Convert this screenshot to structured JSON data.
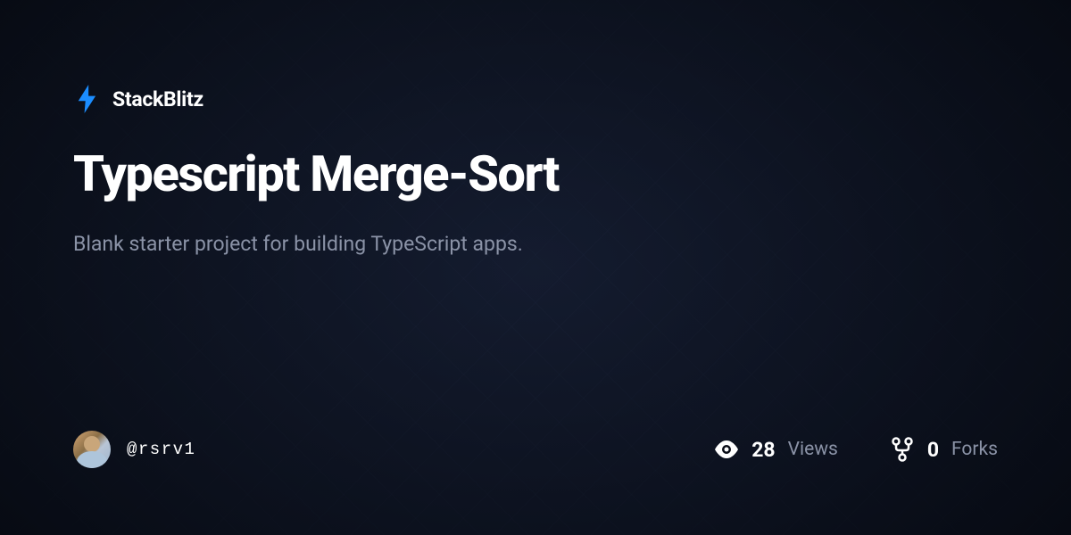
{
  "brand": {
    "name": "StackBlitz"
  },
  "project": {
    "title": "Typescript Merge-Sort",
    "description": "Blank starter project for building TypeScript apps."
  },
  "user": {
    "username": "@rsrv1"
  },
  "stats": {
    "views": {
      "count": "28",
      "label": "Views"
    },
    "forks": {
      "count": "0",
      "label": "Forks"
    }
  },
  "icons": {
    "bolt": "bolt-icon",
    "eye": "eye-icon",
    "fork": "fork-icon"
  }
}
